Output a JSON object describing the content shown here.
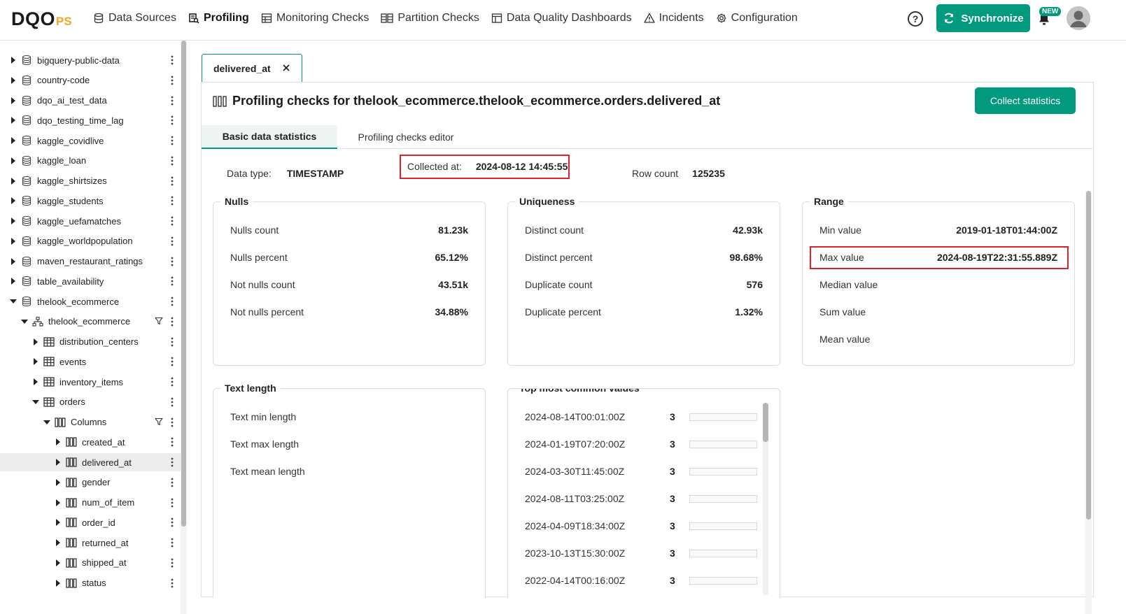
{
  "app": {
    "logo_main": "DQO",
    "logo_sub": "PS"
  },
  "nav": {
    "items": [
      {
        "label": "Data Sources",
        "icon": "database-icon"
      },
      {
        "label": "Profiling",
        "icon": "profiling-icon"
      },
      {
        "label": "Monitoring Checks",
        "icon": "monitor-icon"
      },
      {
        "label": "Partition Checks",
        "icon": "partition-icon"
      },
      {
        "label": "Data Quality Dashboards",
        "icon": "dashboard-icon"
      },
      {
        "label": "Incidents",
        "icon": "warning-icon"
      },
      {
        "label": "Configuration",
        "icon": "gear-icon"
      }
    ],
    "active": "Profiling",
    "help_label": "?",
    "sync_label": "Synchronize",
    "new_badge": "NEW"
  },
  "tree": {
    "items": [
      {
        "label": "bigquery-public-data",
        "level": 0,
        "type": "connection"
      },
      {
        "label": "country-code",
        "level": 0,
        "type": "connection"
      },
      {
        "label": "dqo_ai_test_data",
        "level": 0,
        "type": "connection"
      },
      {
        "label": "dqo_testing_time_lag",
        "level": 0,
        "type": "connection"
      },
      {
        "label": "kaggle_covidlive",
        "level": 0,
        "type": "connection"
      },
      {
        "label": "kaggle_loan",
        "level": 0,
        "type": "connection"
      },
      {
        "label": "kaggle_shirtsizes",
        "level": 0,
        "type": "connection"
      },
      {
        "label": "kaggle_students",
        "level": 0,
        "type": "connection"
      },
      {
        "label": "kaggle_uefamatches",
        "level": 0,
        "type": "connection"
      },
      {
        "label": "kaggle_worldpopulation",
        "level": 0,
        "type": "connection"
      },
      {
        "label": "maven_restaurant_ratings",
        "level": 0,
        "type": "connection"
      },
      {
        "label": "table_availability",
        "level": 0,
        "type": "connection"
      },
      {
        "label": "thelook_ecommerce",
        "level": 0,
        "type": "connection",
        "expanded": true
      },
      {
        "label": "thelook_ecommerce",
        "level": 1,
        "type": "schema",
        "expanded": true,
        "filter": true
      },
      {
        "label": "distribution_centers",
        "level": 2,
        "type": "table"
      },
      {
        "label": "events",
        "level": 2,
        "type": "table"
      },
      {
        "label": "inventory_items",
        "level": 2,
        "type": "table"
      },
      {
        "label": "orders",
        "level": 2,
        "type": "table",
        "expanded": true
      },
      {
        "label": "Columns",
        "level": 3,
        "type": "columns",
        "expanded": true,
        "filter": true
      },
      {
        "label": "created_at",
        "level": 4,
        "type": "column"
      },
      {
        "label": "delivered_at",
        "level": 4,
        "type": "column",
        "selected": true
      },
      {
        "label": "gender",
        "level": 4,
        "type": "column"
      },
      {
        "label": "num_of_item",
        "level": 4,
        "type": "column"
      },
      {
        "label": "order_id",
        "level": 4,
        "type": "column"
      },
      {
        "label": "returned_at",
        "level": 4,
        "type": "column"
      },
      {
        "label": "shipped_at",
        "level": 4,
        "type": "column"
      },
      {
        "label": "status",
        "level": 4,
        "type": "column"
      }
    ]
  },
  "tab": {
    "label": "delivered_at",
    "close_label": "✕"
  },
  "panel": {
    "title": "Profiling checks for thelook_ecommerce.thelook_ecommerce.orders.delivered_at",
    "collect_label": "Collect statistics",
    "subtabs": [
      "Basic data statistics",
      "Profiling checks editor"
    ],
    "info": {
      "data_type_label": "Data type:",
      "data_type_value": "TIMESTAMP",
      "collected_label": "Collected at:",
      "collected_value": "2024-08-12 14:45:55",
      "row_count_label": "Row count",
      "row_count_value": "125235"
    }
  },
  "cards": {
    "nulls": {
      "title": "Nulls",
      "rows": [
        {
          "label": "Nulls count",
          "value": "81.23k"
        },
        {
          "label": "Nulls percent",
          "value": "65.12%"
        },
        {
          "label": "Not nulls count",
          "value": "43.51k"
        },
        {
          "label": "Not nulls percent",
          "value": "34.88%"
        }
      ]
    },
    "uniqueness": {
      "title": "Uniqueness",
      "rows": [
        {
          "label": "Distinct count",
          "value": "42.93k"
        },
        {
          "label": "Distinct percent",
          "value": "98.68%"
        },
        {
          "label": "Duplicate count",
          "value": "576"
        },
        {
          "label": "Duplicate percent",
          "value": "1.32%"
        }
      ]
    },
    "range": {
      "title": "Range",
      "rows": [
        {
          "label": "Min value",
          "value": "2019-01-18T01:44:00Z"
        },
        {
          "label": "Max value",
          "value": "2024-08-19T22:31:55.889Z"
        },
        {
          "label": "Median value",
          "value": ""
        },
        {
          "label": "Sum value",
          "value": ""
        },
        {
          "label": "Mean value",
          "value": ""
        }
      ]
    },
    "text_length": {
      "title": "Text length",
      "rows": [
        {
          "label": "Text min length",
          "value": ""
        },
        {
          "label": "Text max length",
          "value": ""
        },
        {
          "label": "Text mean length",
          "value": ""
        }
      ]
    },
    "top_values": {
      "title": "Top most common values",
      "rows": [
        {
          "value": "2024-08-14T00:01:00Z",
          "count": "3",
          "fill": 0
        },
        {
          "value": "2024-01-19T07:20:00Z",
          "count": "3",
          "fill": 0
        },
        {
          "value": "2024-03-30T11:45:00Z",
          "count": "3",
          "fill": 0
        },
        {
          "value": "2024-08-11T03:25:00Z",
          "count": "3",
          "fill": 0
        },
        {
          "value": "2024-04-09T18:34:00Z",
          "count": "3",
          "fill": 0
        },
        {
          "value": "2023-10-13T15:30:00Z",
          "count": "3",
          "fill": 0
        },
        {
          "value": "2022-04-14T00:16:00Z",
          "count": "3",
          "fill": 0
        }
      ]
    }
  },
  "colors": {
    "accent": "#029a7f",
    "highlight": "#e0202a"
  }
}
